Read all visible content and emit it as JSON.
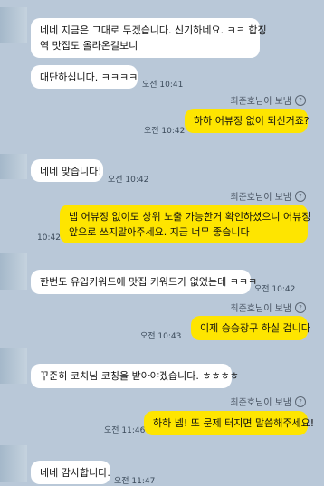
{
  "sender_badge": "최준호님이 보냄",
  "help_glyph": "?",
  "messages": [
    {
      "text": "네네 지금은 그대로 두겠습니다. 신기하네요. ㅋㅋ 합징",
      "text2": "역 맛집도 올라온걸보니",
      "time": ""
    },
    {
      "text": "대단하십니다. ㅋㅋㅋㅋ",
      "time": "오전 10:41"
    },
    {
      "text": "하하 어뷰징 없이 되신거죠?",
      "time": "오전 10:42"
    },
    {
      "text": "네네 맞습니다!",
      "time": "오전 10:42"
    },
    {
      "text": "넵 어뷰징 없이도 상위 노출 가능한거 확인하셨으니 어뷰징",
      "text2": "앞으로 쓰지말아주세요. 지금 너무 좋습니다",
      "time": "10:42"
    },
    {
      "text": "한번도 유입키워드에 맛집 키워드가 없었는데 ㅋㅋㅋ",
      "time": "오전 10:42"
    },
    {
      "text": "이제 승승장구 하실 겁니다",
      "time": "오전 10:43"
    },
    {
      "text": "꾸준히 코치님 코칭을 받아야겠습니다. ㅎㅎㅎㅎ",
      "time": ""
    },
    {
      "text": "하하 넵! 또 문제 터지면 말씀해주세요!",
      "time": "오전 11:46"
    },
    {
      "text": "네네 감사합니다.",
      "time": "오전 11:47"
    }
  ]
}
